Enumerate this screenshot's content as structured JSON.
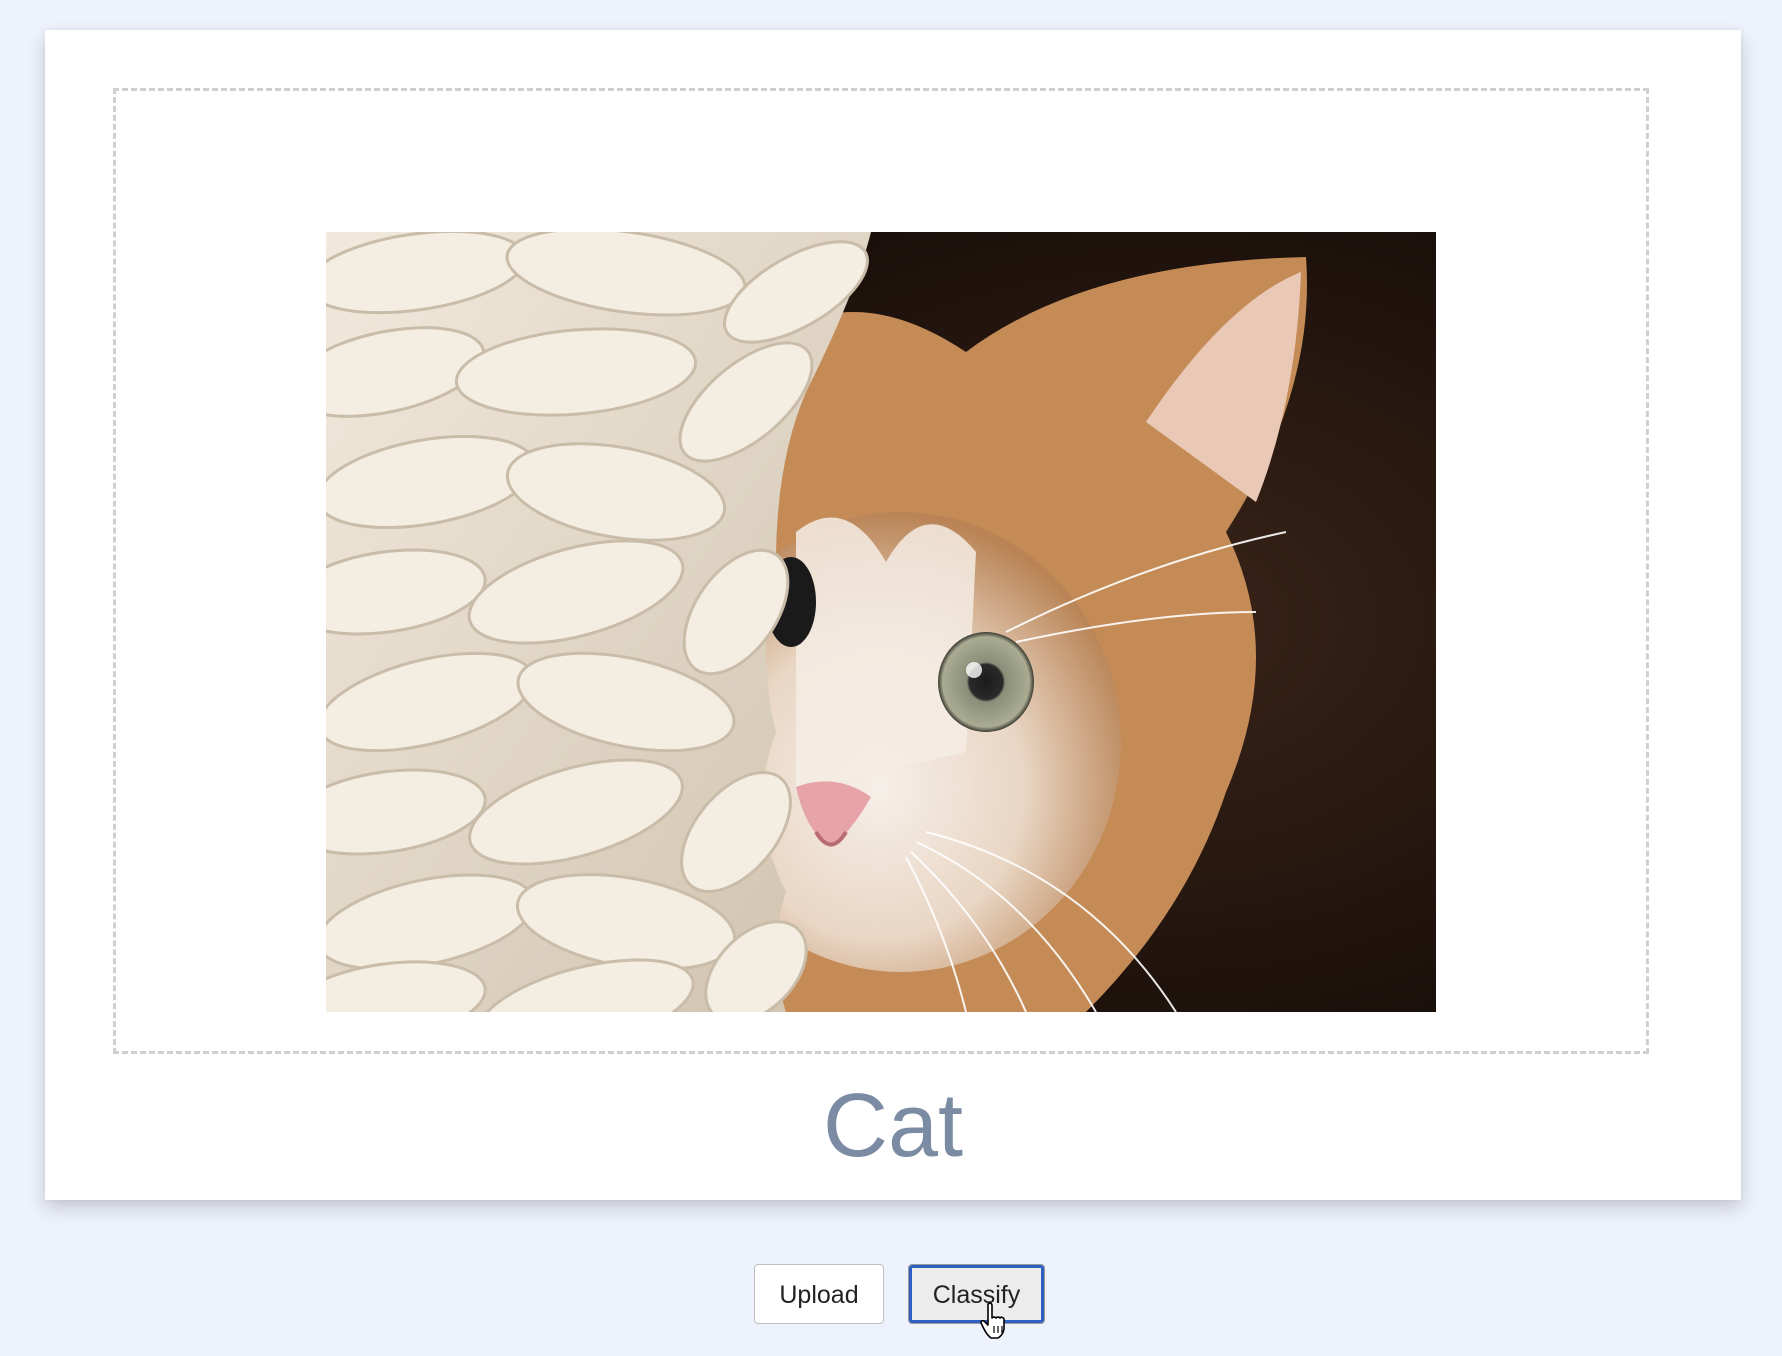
{
  "result": {
    "label": "Cat"
  },
  "image": {
    "icon": "cat-photo",
    "colors": {
      "background": "#1a0f0b",
      "wicker": "#e6dccd",
      "fur_orange": "#c8915c",
      "fur_white": "#f3ece6"
    }
  },
  "buttons": {
    "upload_label": "Upload",
    "classify_label": "Classify"
  },
  "colors": {
    "page_background": "#eef2fc",
    "card_background": "#ffffff",
    "result_text": "#7a8ba3",
    "focus_ring": "#2d5fc0"
  }
}
